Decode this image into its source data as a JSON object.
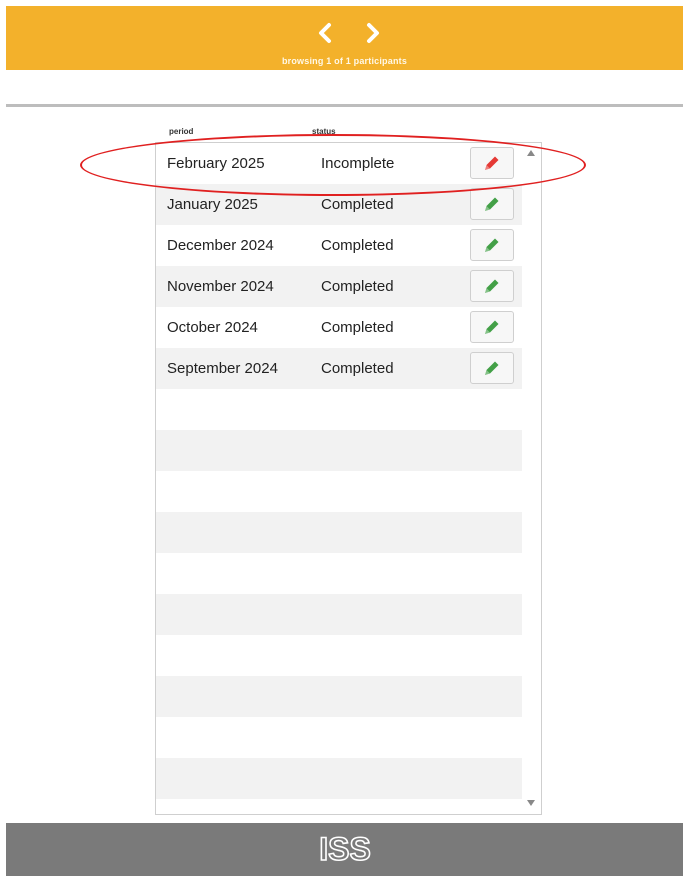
{
  "header": {
    "background": "#f3b12b",
    "prev_icon": "chevron-left-icon",
    "next_icon": "chevron-right-icon",
    "browsing_text": "browsing 1 of 1 participants"
  },
  "columns": {
    "period": "period",
    "status": "status"
  },
  "rows": [
    {
      "period": "February 2025",
      "status": "Incomplete",
      "icon": "pencil-icon",
      "icon_color": "#e53935"
    },
    {
      "period": "January 2025",
      "status": "Completed",
      "icon": "pencil-icon",
      "icon_color": "#43a047"
    },
    {
      "period": "December 2024",
      "status": "Completed",
      "icon": "pencil-icon",
      "icon_color": "#43a047"
    },
    {
      "period": "November 2024",
      "status": "Completed",
      "icon": "pencil-icon",
      "icon_color": "#43a047"
    },
    {
      "period": "October 2024",
      "status": "Completed",
      "icon": "pencil-icon",
      "icon_color": "#43a047"
    },
    {
      "period": "September 2024",
      "status": "Completed",
      "icon": "pencil-icon",
      "icon_color": "#43a047"
    }
  ],
  "annotation": {
    "shape": "ellipse",
    "color": "#e02020"
  },
  "footer": {
    "logo_text": "ISS",
    "background": "#7a7a7a"
  }
}
